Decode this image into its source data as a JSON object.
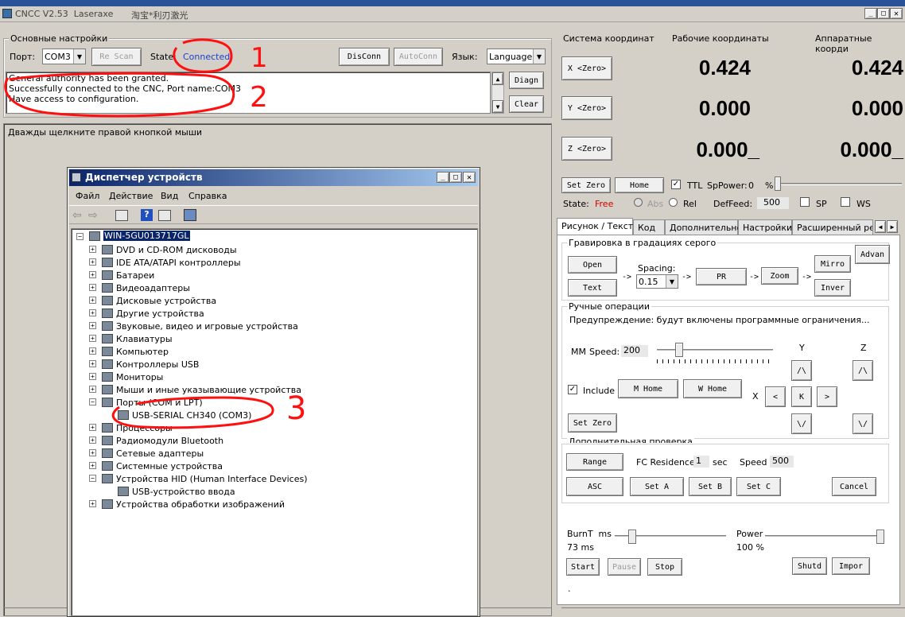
{
  "window": {
    "title": "CNCC V2.53  Laseraxe",
    "title_cn": "淘宝*利刃激光"
  },
  "basic": {
    "group_title": "Основные настройки",
    "port_label": "Порт:",
    "port_value": "COM3",
    "rescan": "Re Scan",
    "state_label": "State:",
    "state_value": "Connected",
    "disconn": "DisConn",
    "autoconn": "AutoConn",
    "lang_label": "Язык:",
    "lang_value": "Language",
    "diagn": "Diagn",
    "clear": "Clear",
    "log": [
      "General authority has been granted.",
      "Successfully connected to the CNC, Port name:COM3",
      "Have access to configuration."
    ]
  },
  "canvas": {
    "hint": "Дважды щелкните правой кнопкой мыши"
  },
  "annotations": [
    "1",
    "2",
    "3"
  ],
  "devmgr": {
    "title": "Диспетчер устройств",
    "menu": [
      "Файл",
      "Действие",
      "Вид",
      "Справка"
    ],
    "root": "WIN-5GU013717GL",
    "items": [
      "DVD и CD-ROM дисководы",
      "IDE ATA/ATAPI контроллеры",
      "Батареи",
      "Видеоадаптеры",
      "Дисковые устройства",
      "Другие устройства",
      "Звуковые, видео и игровые устройства",
      "Клавиатуры",
      "Компьютер",
      "Контроллеры USB",
      "Мониторы",
      "Мыши и иные указывающие устройства",
      "Порты (COM и LPT)",
      "USB-SERIAL CH340 (COM3)",
      "Процессоры",
      "Радиомодули Bluetooth",
      "Сетевые адаптеры",
      "Системные устройства",
      "Устройства HID (Human Interface Devices)",
      "USB-устройство ввода",
      "Устройства обработки изображений"
    ]
  },
  "coords": {
    "header": [
      "Система координат",
      "Рабочие координаты",
      "Аппаратные коорди"
    ],
    "axes": [
      {
        "btn": "X <Zero>",
        "work": "0.424",
        "machine": "0.424"
      },
      {
        "btn": "Y <Zero>",
        "work": "0.000",
        "machine": "0.000"
      },
      {
        "btn": "Z <Zero>",
        "work": "0.000_",
        "machine": "0.000_"
      }
    ],
    "set_zero": "Set Zero",
    "home": "Home",
    "ttl": "TTL",
    "sppower_label": "SpPower:",
    "sppower_value": "0",
    "sppower_unit": "%",
    "state_label": "State:",
    "state_value": "Free",
    "abs": "Abs",
    "rel": "Rel",
    "deffeed_label": "DefFeed:",
    "deffeed_value": "500",
    "sp": "SP",
    "ws": "WS"
  },
  "tabs": [
    "Рисунок / Текст",
    "Код",
    "Дополнительно",
    "Настройки",
    "Расширенный реж"
  ],
  "gray": {
    "title": "Гравировка в градациях серого",
    "open": "Open",
    "text": "Text",
    "spacing_label": "Spacing:",
    "spacing_value": "0.15",
    "pr": "PR",
    "zoom": "Zoom",
    "mirro": "Mirro",
    "inver": "Inver",
    "advan": "Advan",
    "arrow": "->"
  },
  "manual": {
    "title": "Ручные операции",
    "warning": "Предупреждение: будут включены программные ограничения...",
    "mm_label": "MM",
    "speed_label": "Speed:",
    "speed_value": "200",
    "y_label": "Y",
    "z_label": "Z",
    "x_label": "X",
    "include_z": "Include Z",
    "m_home": "M Home",
    "w_home": "W Home",
    "set_zero": "Set Zero",
    "up": "/\\",
    "down": "\\/",
    "left": "<",
    "right": ">",
    "k": "K"
  },
  "extra": {
    "title": "Дополнительная проверка",
    "range": "Range",
    "fc_label": "FC Residence",
    "fc_value": "1",
    "fc_unit": "sec",
    "speed_label": "Speed",
    "speed_value": "500",
    "asc": "ASC",
    "set_a": "Set A",
    "set_b": "Set B",
    "set_c": "Set C",
    "cancel": "Cancel"
  },
  "burn": {
    "burnt_label": "BurnT  ms",
    "burnt_value": "73 ms",
    "power_label": "Power",
    "power_value": "100 %",
    "start": "Start",
    "pause": "Pause",
    "stop": "Stop",
    "shutd": "Shutd",
    "impor": "Impor",
    "dot": "."
  }
}
